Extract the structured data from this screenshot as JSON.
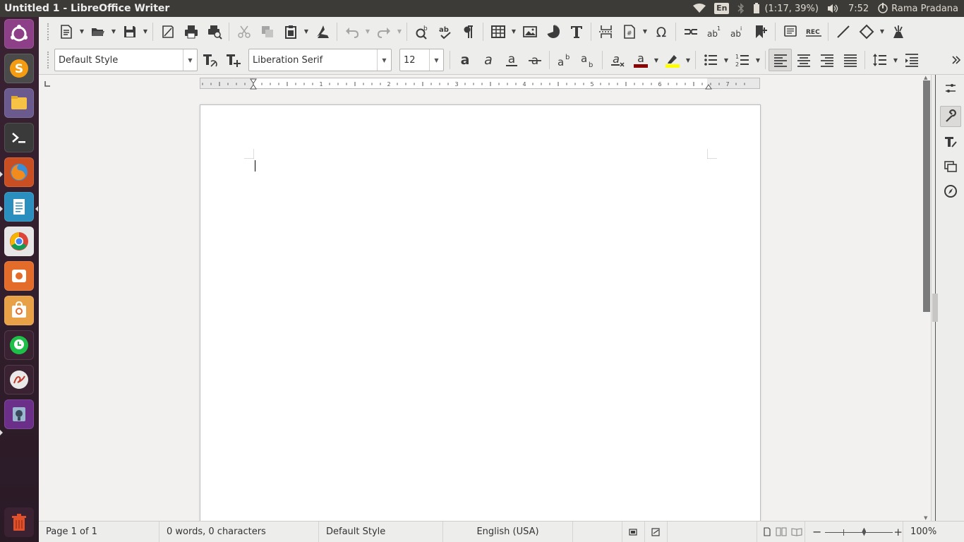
{
  "window": {
    "title": "Untitled 1 - LibreOffice Writer"
  },
  "panel": {
    "language": "En",
    "battery": "(1:17, 39%)",
    "time": "7:52",
    "user": "Rama Pradana"
  },
  "launcher": {
    "items": [
      {
        "name": "ubuntu-dash",
        "color": "#8d3f87"
      },
      {
        "name": "sublime-text",
        "color": "#555"
      },
      {
        "name": "files",
        "color": "#6a5a8a"
      },
      {
        "name": "terminal",
        "color": "#3c3c3c"
      },
      {
        "name": "firefox",
        "color": "#d4542c"
      },
      {
        "name": "libreoffice-writer",
        "color": "#2a8fbf"
      },
      {
        "name": "chrome",
        "color": "#e9e9e9"
      },
      {
        "name": "app-orange",
        "color": "#e36c2b"
      },
      {
        "name": "ubuntu-software",
        "color": "#e8a146"
      },
      {
        "name": "line",
        "color": "#1dbf48"
      },
      {
        "name": "signature-app",
        "color": "#dddddd"
      },
      {
        "name": "screenshot-app",
        "color": "#6b2f8a"
      },
      {
        "name": "trash",
        "color": "#3b2233"
      }
    ]
  },
  "formatting": {
    "paragraph_style": "Default Style",
    "font_name": "Liberation Serif",
    "font_size": "12"
  },
  "statusbar": {
    "page": "Page 1 of 1",
    "words": "0 words, 0 characters",
    "style": "Default Style",
    "language": "English (USA)",
    "zoom": "100%"
  },
  "colors": {
    "font_color": "#8b0000",
    "highlight_color": "#ffff00"
  },
  "ruler": {
    "labels": [
      "1",
      "2",
      "3",
      "4",
      "5",
      "6",
      "7"
    ]
  }
}
